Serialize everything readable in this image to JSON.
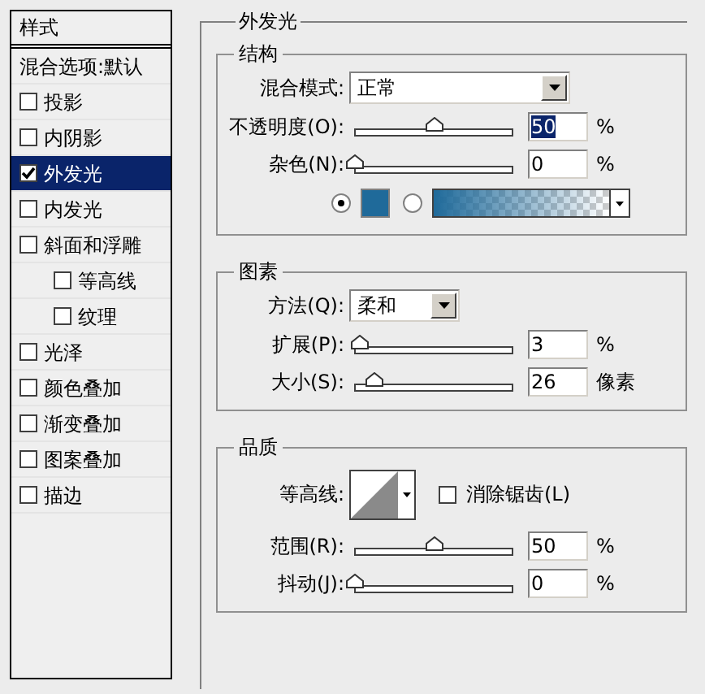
{
  "styles_panel": {
    "title": "样式",
    "items": [
      {
        "label": "混合选项:默认",
        "kind": "plain",
        "selected": false
      },
      {
        "label": "投影",
        "kind": "checkbox",
        "checked": false,
        "selected": false
      },
      {
        "label": "内阴影",
        "kind": "checkbox",
        "checked": false,
        "selected": false
      },
      {
        "label": "外发光",
        "kind": "checkbox",
        "checked": true,
        "selected": true
      },
      {
        "label": "内发光",
        "kind": "checkbox",
        "checked": false,
        "selected": false
      },
      {
        "label": "斜面和浮雕",
        "kind": "checkbox",
        "checked": false,
        "selected": false,
        "children": [
          {
            "label": "等高线",
            "kind": "checkbox",
            "checked": false,
            "selected": false
          },
          {
            "label": "纹理",
            "kind": "checkbox",
            "checked": false,
            "selected": false
          }
        ]
      },
      {
        "label": "光泽",
        "kind": "checkbox",
        "checked": false,
        "selected": false
      },
      {
        "label": "颜色叠加",
        "kind": "checkbox",
        "checked": false,
        "selected": false
      },
      {
        "label": "渐变叠加",
        "kind": "checkbox",
        "checked": false,
        "selected": false
      },
      {
        "label": "图案叠加",
        "kind": "checkbox",
        "checked": false,
        "selected": false
      },
      {
        "label": "描边",
        "kind": "checkbox",
        "checked": false,
        "selected": false
      }
    ]
  },
  "panel": {
    "title": "外发光",
    "groups": [
      {
        "title": "结构",
        "rows": [
          {
            "kind": "select",
            "label": "混合模式:",
            "value": "正常",
            "wide": true
          },
          {
            "kind": "slider",
            "label": "不透明度(O):",
            "level": 0.5,
            "value": "50",
            "unit": "%",
            "text_selected": true
          },
          {
            "kind": "slider",
            "label": "杂色(N):",
            "level": 0,
            "value": "0",
            "unit": "%",
            "text_selected": false
          },
          {
            "kind": "color",
            "options": [
              {
                "kind": "swatch",
                "selected": true,
                "color": "#1f6a9a"
              },
              {
                "kind": "gradient",
                "selected": false
              }
            ]
          }
        ]
      },
      {
        "title": "图素",
        "rows": [
          {
            "kind": "select",
            "label": "方法(Q):",
            "value": "柔和",
            "wide": false
          },
          {
            "kind": "slider",
            "label": "扩展(P):",
            "level": 0.03,
            "value": "3",
            "unit": "%",
            "text_selected": false
          },
          {
            "kind": "slider",
            "label": "大小(S):",
            "level": 0.12,
            "value": "26",
            "unit": "像素",
            "text_selected": false
          }
        ]
      },
      {
        "title": "品质",
        "rows": [
          {
            "kind": "contour",
            "label": "等高线:",
            "checkbox": {
              "label": "消除锯齿(L)",
              "checked": false
            }
          },
          {
            "kind": "slider",
            "label": "范围(R):",
            "level": 0.5,
            "value": "50",
            "unit": "%",
            "text_selected": false
          },
          {
            "kind": "slider",
            "label": "抖动(J):",
            "level": 0,
            "value": "0",
            "unit": "%",
            "text_selected": false
          }
        ]
      }
    ]
  }
}
